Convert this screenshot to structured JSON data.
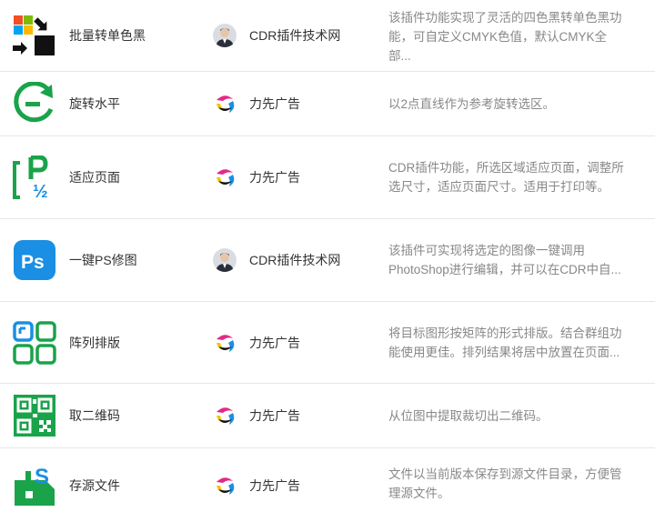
{
  "plugins": [
    {
      "name": "批量转单色黑",
      "icon": "four-color-to-black-icon",
      "author": "CDR插件技术网",
      "avatar": "person",
      "desc1": "该插件功能实现了灵活的四色黑转单色黑功",
      "desc2": "能，可自定义CMYK色值，默认CMYK全部..."
    },
    {
      "name": "旋转水平",
      "icon": "rotate-horizontal-icon",
      "author": "力先广告",
      "avatar": "lixian",
      "desc1": "以2点直线作为参考旋转选区。",
      "desc2": ""
    },
    {
      "name": "适应页面",
      "icon": "fit-page-icon",
      "author": "力先广告",
      "avatar": "lixian",
      "desc1": "CDR插件功能，所选区域适应页面，调整所",
      "desc2": "选尺寸，适应页面尺寸。适用于打印等。"
    },
    {
      "name": "一键PS修图",
      "icon": "ps-icon",
      "author": "CDR插件技术网",
      "avatar": "person",
      "desc1": "该插件可实现将选定的图像一键调用",
      "desc2": "PhotoShop进行编辑，并可以在CDR中自..."
    },
    {
      "name": "阵列排版",
      "icon": "array-layout-icon",
      "author": "力先广告",
      "avatar": "lixian",
      "desc1": "将目标图形按矩阵的形式排版。结合群组功",
      "desc2": "能使用更佳。排列结果将居中放置在页面..."
    },
    {
      "name": "取二维码",
      "icon": "qr-code-icon",
      "author": "力先广告",
      "avatar": "lixian",
      "desc1": "从位图中提取裁切出二维码。",
      "desc2": ""
    },
    {
      "name": "存源文件",
      "icon": "save-source-icon",
      "author": "力先广告",
      "avatar": "lixian",
      "desc1": "文件以当前版本保存到源文件目录，方便管",
      "desc2": "理源文件。"
    }
  ],
  "colors": {
    "green": "#1aa34a",
    "blue": "#1a8fe3",
    "text": "#333333",
    "muted": "#888888"
  }
}
